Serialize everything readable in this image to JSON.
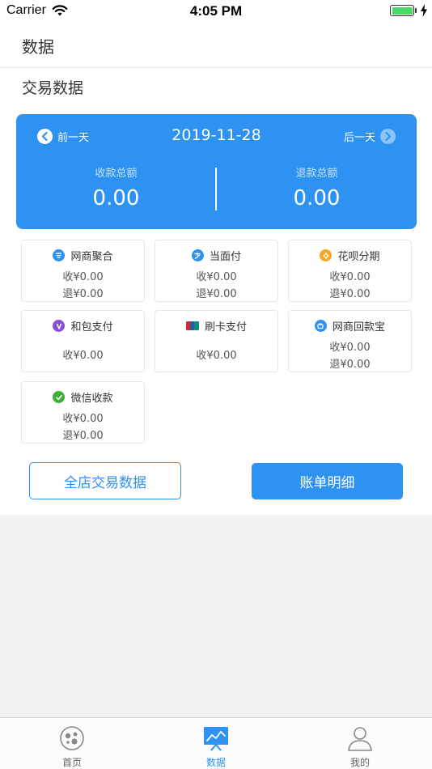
{
  "status_bar": {
    "carrier": "Carrier",
    "time": "4:05 PM"
  },
  "nav": {
    "title": "数据"
  },
  "section": {
    "title": "交易数据"
  },
  "summary": {
    "prev_label": "前一天",
    "next_label": "后一天",
    "date": "2019-11-28",
    "income_label": "收款总额",
    "income_value": "0.00",
    "refund_label": "退款总额",
    "refund_value": "0.00"
  },
  "channels": [
    {
      "name": "网商聚合",
      "income": "收¥0.00",
      "refund": "退¥0.00",
      "icon": "wangshang-icon",
      "color": "#2e92f2"
    },
    {
      "name": "当面付",
      "income": "收¥0.00",
      "refund": "退¥0.00",
      "icon": "alipay-icon",
      "color": "#2e92f2"
    },
    {
      "name": "花呗分期",
      "income": "收¥0.00",
      "refund": "退¥0.00",
      "icon": "huabei-icon",
      "color": "#f5a623"
    },
    {
      "name": "和包支付",
      "income": "收¥0.00",
      "icon": "hebao-icon",
      "color": "#8a4fd6"
    },
    {
      "name": "刷卡支付",
      "income": "收¥0.00",
      "icon": "unionpay-icon",
      "color": "#1a5fa8"
    },
    {
      "name": "网商回款宝",
      "income": "收¥0.00",
      "refund": "退¥0.00",
      "icon": "huikuanbao-icon",
      "color": "#2e92f2"
    },
    {
      "name": "微信收款",
      "income": "收¥0.00",
      "refund": "退¥0.00",
      "icon": "wechat-icon",
      "color": "#3cb034"
    }
  ],
  "actions": {
    "all_store_label": "全店交易数据",
    "bill_detail_label": "账单明细"
  },
  "tabs": [
    {
      "label": "首页",
      "icon": "home-icon",
      "active": false
    },
    {
      "label": "数据",
      "icon": "data-chart-icon",
      "active": true
    },
    {
      "label": "我的",
      "icon": "profile-icon",
      "active": false
    }
  ],
  "colors": {
    "accent": "#2e92f2",
    "background": "#f2f2f2",
    "battery": "#4cd964"
  }
}
